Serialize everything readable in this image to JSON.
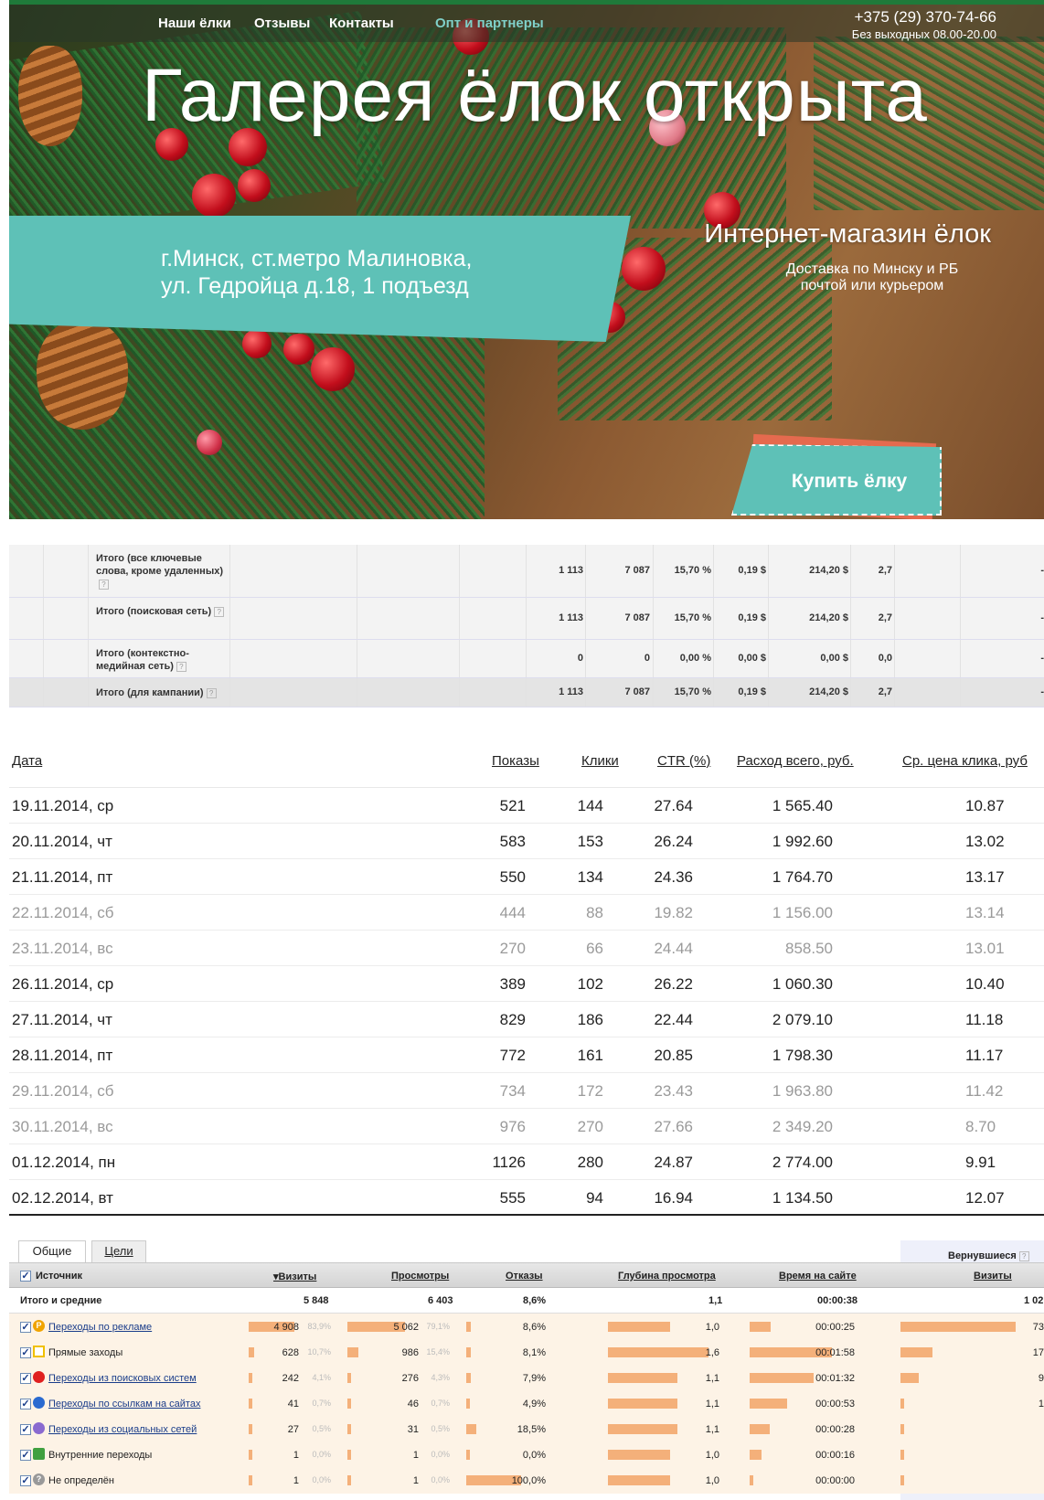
{
  "nav": {
    "items": [
      "Наши ёлки",
      "Отзывы",
      "Контакты",
      "Опт и партнеры"
    ],
    "phone": "+375 (29) 370-74-66",
    "hours": "Без выходных 08.00-20.00"
  },
  "hero": {
    "title": "Галерея ёлок открыта",
    "address_line1": "г.Минск, ст.метро Малиновка,",
    "address_line2": "ул. Гедройца д.18, 1 подъезд",
    "shop": "Интернет-магазин ёлок",
    "delivery_line1": "Доставка по Минску и РБ",
    "delivery_line2": "почтой или курьером",
    "buy": "Купить ёлку"
  },
  "campaign": {
    "rows": [
      {
        "label": "Итого (все ключевые слова, кроме удаленных)",
        "v": [
          "1 113",
          "7 087",
          "15,70 %",
          "0,19 $",
          "214,20 $",
          "2,7"
        ]
      },
      {
        "label": "Итого (поисковая сеть)",
        "v": [
          "1 113",
          "7 087",
          "15,70 %",
          "0,19 $",
          "214,20 $",
          "2,7"
        ]
      },
      {
        "label": "Итого (контекстно-медийная сеть)",
        "v": [
          "0",
          "0",
          "0,00 %",
          "0,00 $",
          "0,00 $",
          "0,0"
        ]
      },
      {
        "label": "Итого (для кампании)",
        "v": [
          "1 113",
          "7 087",
          "15,70 %",
          "0,19 $",
          "214,20 $",
          "2,7"
        ]
      }
    ],
    "trailing": "-"
  },
  "daily": {
    "headers": [
      "Дата",
      "Показы",
      "Клики",
      "CTR (%)",
      "Расход всего, руб.",
      "Ср. цена клика, руб"
    ],
    "rows": [
      {
        "date": "19.11.2014, ср",
        "shows": "521",
        "clicks": "144",
        "ctr": "27.64",
        "cost": "1 565.40",
        "cpc": "10.87",
        "we": false
      },
      {
        "date": "20.11.2014, чт",
        "shows": "583",
        "clicks": "153",
        "ctr": "26.24",
        "cost": "1 992.60",
        "cpc": "13.02",
        "we": false
      },
      {
        "date": "21.11.2014, пт",
        "shows": "550",
        "clicks": "134",
        "ctr": "24.36",
        "cost": "1 764.70",
        "cpc": "13.17",
        "we": false
      },
      {
        "date": "22.11.2014, сб",
        "shows": "444",
        "clicks": "88",
        "ctr": "19.82",
        "cost": "1 156.00",
        "cpc": "13.14",
        "we": true
      },
      {
        "date": "23.11.2014, вс",
        "shows": "270",
        "clicks": "66",
        "ctr": "24.44",
        "cost": "858.50",
        "cpc": "13.01",
        "we": true
      },
      {
        "date": "26.11.2014, ср",
        "shows": "389",
        "clicks": "102",
        "ctr": "26.22",
        "cost": "1 060.30",
        "cpc": "10.40",
        "we": false
      },
      {
        "date": "27.11.2014, чт",
        "shows": "829",
        "clicks": "186",
        "ctr": "22.44",
        "cost": "2 079.10",
        "cpc": "11.18",
        "we": false
      },
      {
        "date": "28.11.2014, пт",
        "shows": "772",
        "clicks": "161",
        "ctr": "20.85",
        "cost": "1 798.30",
        "cpc": "11.17",
        "we": false
      },
      {
        "date": "29.11.2014, сб",
        "shows": "734",
        "clicks": "172",
        "ctr": "23.43",
        "cost": "1 963.80",
        "cpc": "11.42",
        "we": true
      },
      {
        "date": "30.11.2014, вс",
        "shows": "976",
        "clicks": "270",
        "ctr": "27.66",
        "cost": "2 349.20",
        "cpc": "8.70",
        "we": true
      },
      {
        "date": "01.12.2014, пн",
        "shows": "1126",
        "clicks": "280",
        "ctr": "24.87",
        "cost": "2 774.00",
        "cpc": "9.91",
        "we": false
      },
      {
        "date": "02.12.2014, вт",
        "shows": "555",
        "clicks": "94",
        "ctr": "16.94",
        "cost": "1 134.50",
        "cpc": "12.07",
        "we": false
      }
    ]
  },
  "metrika": {
    "tabs": [
      "Общие",
      "Цели"
    ],
    "returning": "Вернувшиеся",
    "headers": [
      "Источник",
      "Визиты",
      "Просмотры",
      "Отказы",
      "Глубина просмотра",
      "Время на сайте",
      "Визиты"
    ],
    "total": {
      "label": "Итого и средние",
      "visits": "5 848",
      "views": "6 403",
      "bounce": "8,6%",
      "depth": "1,1",
      "time": "00:00:38",
      "ret": "1 02"
    },
    "rows": [
      {
        "name": "Переходы по рекламе",
        "link": true,
        "visits": "4 908",
        "vp": "83,9%",
        "views": "5 062",
        "wp": "79,1%",
        "bounce": "8,6%",
        "depth": "1,0",
        "time": "00:00:25",
        "ret": "73",
        "icon": "ad-icon",
        "color": "#f0a400",
        "vis_frac": 0.839,
        "view_frac": 0.791,
        "bounce_frac": 0.086,
        "depth_frac": 0.62,
        "time_frac": 0.25,
        "ret_frac": 0.9
      },
      {
        "name": "Прямые заходы",
        "link": false,
        "visits": "628",
        "vp": "10,7%",
        "views": "986",
        "wp": "15,4%",
        "bounce": "8,1%",
        "depth": "1,6",
        "time": "00:01:58",
        "ret": "17",
        "icon": "direct-icon",
        "color": "#f0c000",
        "vis_frac": 0.107,
        "view_frac": 0.154,
        "bounce_frac": 0.081,
        "depth_frac": 1.0,
        "time_frac": 1.0,
        "ret_frac": 0.25
      },
      {
        "name": "Переходы из поисковых систем",
        "link": true,
        "visits": "242",
        "vp": "4,1%",
        "views": "276",
        "wp": "4,3%",
        "bounce": "7,9%",
        "depth": "1,1",
        "time": "00:01:32",
        "ret": "9",
        "icon": "search-icon",
        "color": "#e02020",
        "vis_frac": 0.041,
        "view_frac": 0.043,
        "bounce_frac": 0.079,
        "depth_frac": 0.69,
        "time_frac": 0.78,
        "ret_frac": 0.14
      },
      {
        "name": "Переходы по ссылкам на сайтах",
        "link": true,
        "visits": "41",
        "vp": "0,7%",
        "views": "46",
        "wp": "0,7%",
        "bounce": "4,9%",
        "depth": "1,1",
        "time": "00:00:53",
        "ret": "1",
        "icon": "link-icon",
        "color": "#2a6ad0",
        "vis_frac": 0.007,
        "view_frac": 0.007,
        "bounce_frac": 0.049,
        "depth_frac": 0.69,
        "time_frac": 0.45,
        "ret_frac": 0.02
      },
      {
        "name": "Переходы из социальных сетей",
        "link": true,
        "visits": "27",
        "vp": "0,5%",
        "views": "31",
        "wp": "0,5%",
        "bounce": "18,5%",
        "depth": "1,1",
        "time": "00:00:28",
        "ret": "",
        "icon": "social-icon",
        "color": "#8a6ad0",
        "vis_frac": 0.005,
        "view_frac": 0.005,
        "bounce_frac": 0.185,
        "depth_frac": 0.69,
        "time_frac": 0.24,
        "ret_frac": 0.01
      },
      {
        "name": "Внутренние переходы",
        "link": false,
        "visits": "1",
        "vp": "0,0%",
        "views": "1",
        "wp": "0,0%",
        "bounce": "0,0%",
        "depth": "1,0",
        "time": "00:00:16",
        "ret": "",
        "icon": "home-icon",
        "color": "#40a040",
        "vis_frac": 0.0,
        "view_frac": 0.0,
        "bounce_frac": 0.0,
        "depth_frac": 0.62,
        "time_frac": 0.14,
        "ret_frac": 0.01
      },
      {
        "name": "Не определён",
        "link": false,
        "visits": "1",
        "vp": "0,0%",
        "views": "1",
        "wp": "0,0%",
        "bounce": "100,0%",
        "depth": "1,0",
        "time": "00:00:00",
        "ret": "",
        "icon": "unknown-icon",
        "color": "#999999",
        "vis_frac": 0.0,
        "view_frac": 0.0,
        "bounce_frac": 1.0,
        "depth_frac": 0.62,
        "time_frac": 0.0,
        "ret_frac": 0.01
      }
    ]
  }
}
